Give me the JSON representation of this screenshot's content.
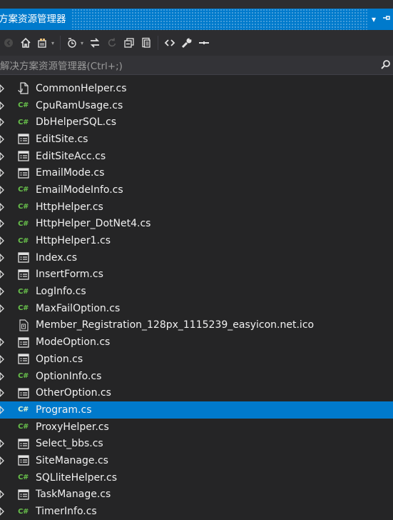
{
  "title": "方案资源管理器",
  "search": {
    "placeholder": "解决方案资源管理器(Ctrl+;)"
  },
  "accent": "#007acc",
  "files": [
    {
      "name": "CommonHelper.cs",
      "icon": "document-icon",
      "expandable": true
    },
    {
      "name": "CpuRamUsage.cs",
      "icon": "csharp-icon",
      "expandable": true
    },
    {
      "name": "DbHelperSQL.cs",
      "icon": "csharp-icon",
      "expandable": true
    },
    {
      "name": "EditSite.cs",
      "icon": "form-icon",
      "expandable": true
    },
    {
      "name": "EditSiteAcc.cs",
      "icon": "form-icon",
      "expandable": true
    },
    {
      "name": "EmailMode.cs",
      "icon": "form-icon",
      "expandable": true
    },
    {
      "name": "EmailModeInfo.cs",
      "icon": "csharp-icon",
      "expandable": true
    },
    {
      "name": "HttpHelper.cs",
      "icon": "csharp-icon",
      "expandable": true
    },
    {
      "name": "HttpHelper_DotNet4.cs",
      "icon": "csharp-icon",
      "expandable": true
    },
    {
      "name": "HttpHelper1.cs",
      "icon": "csharp-icon",
      "expandable": true
    },
    {
      "name": "Index.cs",
      "icon": "form-icon",
      "expandable": true
    },
    {
      "name": "InsertForm.cs",
      "icon": "form-icon",
      "expandable": true
    },
    {
      "name": "LogInfo.cs",
      "icon": "csharp-icon",
      "expandable": true
    },
    {
      "name": "MaxFailOption.cs",
      "icon": "csharp-icon",
      "expandable": true
    },
    {
      "name": "Member_Registration_128px_1115239_easyicon.net.ico",
      "icon": "ico-file-icon",
      "expandable": false
    },
    {
      "name": "ModeOption.cs",
      "icon": "form-icon",
      "expandable": true
    },
    {
      "name": "Option.cs",
      "icon": "form-icon",
      "expandable": true
    },
    {
      "name": "OptionInfo.cs",
      "icon": "csharp-icon",
      "expandable": true
    },
    {
      "name": "OtherOption.cs",
      "icon": "form-icon",
      "expandable": true
    },
    {
      "name": "Program.cs",
      "icon": "csharp-icon",
      "expandable": true,
      "selected": true
    },
    {
      "name": "ProxyHelper.cs",
      "icon": "csharp-icon",
      "expandable": false
    },
    {
      "name": "Select_bbs.cs",
      "icon": "form-icon",
      "expandable": true
    },
    {
      "name": "SiteManage.cs",
      "icon": "form-icon",
      "expandable": true
    },
    {
      "name": "SQLliteHelper.cs",
      "icon": "csharp-icon",
      "expandable": false
    },
    {
      "name": "TaskManage.cs",
      "icon": "form-icon",
      "expandable": true
    },
    {
      "name": "TimerInfo.cs",
      "icon": "csharp-icon",
      "expandable": true
    }
  ]
}
